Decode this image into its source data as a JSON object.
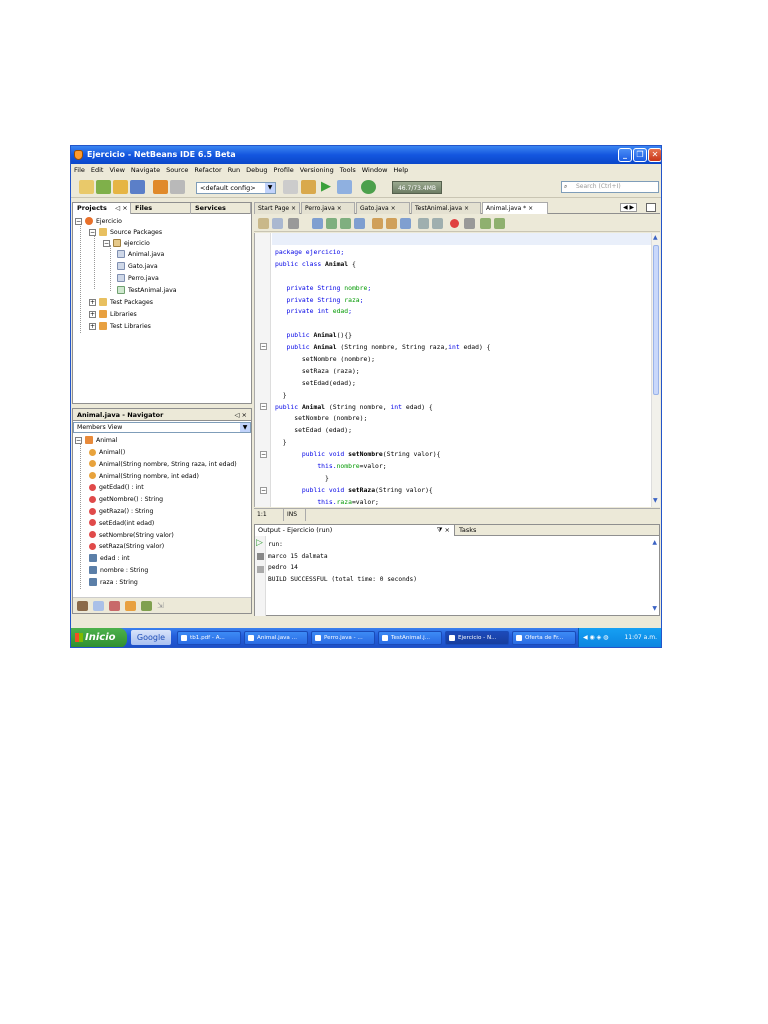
{
  "window": {
    "title": "Ejercicio - NetBeans IDE 6.5 Beta",
    "minimize_glyph": "_",
    "restore_glyph": "❐",
    "close_glyph": "✕"
  },
  "menu": [
    "File",
    "Edit",
    "View",
    "Navigate",
    "Source",
    "Refactor",
    "Run",
    "Debug",
    "Profile",
    "Versioning",
    "Tools",
    "Window",
    "Help"
  ],
  "toolbar": {
    "config_value": "<default config>",
    "memory_text": "46.7/73.4MB",
    "search_placeholder": "Search (Ctrl+I)"
  },
  "projects_panel": {
    "tabs": [
      "Projects",
      "Files",
      "Services"
    ],
    "close_glyph": "◁ ×",
    "tree": [
      {
        "label": "Ejercicio",
        "icon": "project-icon"
      },
      {
        "label": "Source Packages",
        "icon": "folder-icon"
      },
      {
        "label": "ejercicio",
        "icon": "package-icon"
      },
      {
        "label": "Animal.java",
        "icon": "java-file-icon"
      },
      {
        "label": "Gato.java",
        "icon": "java-file-icon"
      },
      {
        "label": "Perro.java",
        "icon": "java-file-icon"
      },
      {
        "label": "TestAnimal.java",
        "icon": "java-file-icon"
      },
      {
        "label": "Test Packages",
        "icon": "folder-icon"
      },
      {
        "label": "Libraries",
        "icon": "folder-icon"
      },
      {
        "label": "Test Libraries",
        "icon": "folder-icon"
      }
    ]
  },
  "navigator": {
    "title": "Animal.java - Navigator",
    "close_glyph": "◁ ×",
    "view": "Members View",
    "root": "Animal",
    "members": [
      {
        "label": "Animal()",
        "kind": "constructor",
        "color": "#e8a33d"
      },
      {
        "label": "Animal(String nombre, String raza, int edad)",
        "kind": "constructor",
        "color": "#e8a33d"
      },
      {
        "label": "Animal(String nombre, int edad)",
        "kind": "constructor",
        "color": "#e8a33d"
      },
      {
        "label": "getEdad() : int",
        "kind": "method",
        "color": "#e04a4a"
      },
      {
        "label": "getNombre() : String",
        "kind": "method",
        "color": "#e04a4a"
      },
      {
        "label": "getRaza() : String",
        "kind": "method",
        "color": "#e04a4a"
      },
      {
        "label": "setEdad(int edad)",
        "kind": "method",
        "color": "#e04a4a"
      },
      {
        "label": "setNombre(String valor)",
        "kind": "method",
        "color": "#e04a4a"
      },
      {
        "label": "setRaza(String valor)",
        "kind": "method",
        "color": "#e04a4a"
      },
      {
        "label": "edad : int",
        "kind": "field",
        "color": "#5b7fa8"
      },
      {
        "label": "nombre : String",
        "kind": "field",
        "color": "#5b7fa8"
      },
      {
        "label": "raza : String",
        "kind": "field",
        "color": "#5b7fa8"
      }
    ]
  },
  "editor": {
    "tabs": [
      {
        "label": "Start Page",
        "active": false
      },
      {
        "label": "Perro.java",
        "active": false
      },
      {
        "label": "Gato.java",
        "active": false
      },
      {
        "label": "TestAnimal.java",
        "active": false
      },
      {
        "label": "Animal.java *",
        "active": true
      }
    ],
    "tab_close_glyph": "×",
    "nav_arrows": "◀ ▶",
    "code": [
      [
        {
          "t": "package ejercicio;",
          "c": "kw"
        }
      ],
      [
        {
          "t": "public class ",
          "c": "kw"
        },
        {
          "t": "Animal",
          "c": "b"
        },
        {
          "t": " {",
          "c": ""
        }
      ],
      [],
      [
        {
          "t": "   private String ",
          "c": "kw"
        },
        {
          "t": "nombre",
          "c": "fld"
        },
        {
          "t": ";",
          "c": "kw"
        }
      ],
      [
        {
          "t": "   private String ",
          "c": "kw"
        },
        {
          "t": "raza",
          "c": "fld"
        },
        {
          "t": ";",
          "c": "kw"
        }
      ],
      [
        {
          "t": "   private int ",
          "c": "kw"
        },
        {
          "t": "edad",
          "c": "fld"
        },
        {
          "t": ";",
          "c": "kw"
        }
      ],
      [],
      [
        {
          "t": "   public ",
          "c": "kw"
        },
        {
          "t": "Animal",
          "c": "b"
        },
        {
          "t": "(){}",
          "c": ""
        }
      ],
      [
        {
          "t": "   public ",
          "c": "kw"
        },
        {
          "t": "Animal",
          "c": "b"
        },
        {
          "t": " (String nombre, String raza,",
          "c": ""
        },
        {
          "t": "int",
          "c": "kw"
        },
        {
          "t": " edad) {",
          "c": ""
        }
      ],
      [
        {
          "t": "       setNombre (nombre);",
          "c": ""
        }
      ],
      [
        {
          "t": "       setRaza (raza);",
          "c": ""
        }
      ],
      [
        {
          "t": "       setEdad(edad);",
          "c": ""
        }
      ],
      [
        {
          "t": "  }",
          "c": ""
        }
      ],
      [
        {
          "t": "public ",
          "c": "kw"
        },
        {
          "t": "Animal",
          "c": "b"
        },
        {
          "t": " (String nombre, ",
          "c": ""
        },
        {
          "t": "int",
          "c": "kw"
        },
        {
          "t": " edad) {",
          "c": ""
        }
      ],
      [
        {
          "t": "     setNombre (nombre);",
          "c": ""
        }
      ],
      [
        {
          "t": "     setEdad (edad);",
          "c": ""
        }
      ],
      [
        {
          "t": "  }",
          "c": ""
        }
      ],
      [
        {
          "t": "       public void ",
          "c": "kw"
        },
        {
          "t": "setNombre",
          "c": "b"
        },
        {
          "t": "(String valor){",
          "c": ""
        }
      ],
      [
        {
          "t": "           this.",
          "c": "kw"
        },
        {
          "t": "nombre",
          "c": "fld"
        },
        {
          "t": "=valor;",
          "c": ""
        }
      ],
      [
        {
          "t": "             }",
          "c": ""
        }
      ],
      [
        {
          "t": "       public void ",
          "c": "kw"
        },
        {
          "t": "setRaza",
          "c": "b"
        },
        {
          "t": "(String valor){",
          "c": ""
        }
      ],
      [
        {
          "t": "           this.",
          "c": "kw"
        },
        {
          "t": "raza",
          "c": "fld"
        },
        {
          "t": "=valor;",
          "c": ""
        }
      ]
    ],
    "status_position": "1:1",
    "status_mode": "INS"
  },
  "output": {
    "tab_label": "Output - Ejercicio (run)",
    "tab_controls": "⧩ ×",
    "tasks_label": "Tasks",
    "lines": [
      "run:",
      "marco 15 dalmata",
      "pedro 14",
      "BUILD SUCCESSFUL (total time: 0 seconds)"
    ]
  },
  "taskbar": {
    "start_label": "Inicio",
    "google_label": "Google",
    "tasks": [
      {
        "label": "tb1.pdf - A...",
        "active": false
      },
      {
        "label": "Animal.java ...",
        "active": false
      },
      {
        "label": "Perro.java - ...",
        "active": false
      },
      {
        "label": "TestAnimal.j...",
        "active": false
      },
      {
        "label": "Ejercicio - N...",
        "active": true
      },
      {
        "label": "Oferta de Fr...",
        "active": false
      }
    ],
    "clock": "11:07 a.m.",
    "tray_icons": "◀ ◉ ◈ ◍"
  }
}
